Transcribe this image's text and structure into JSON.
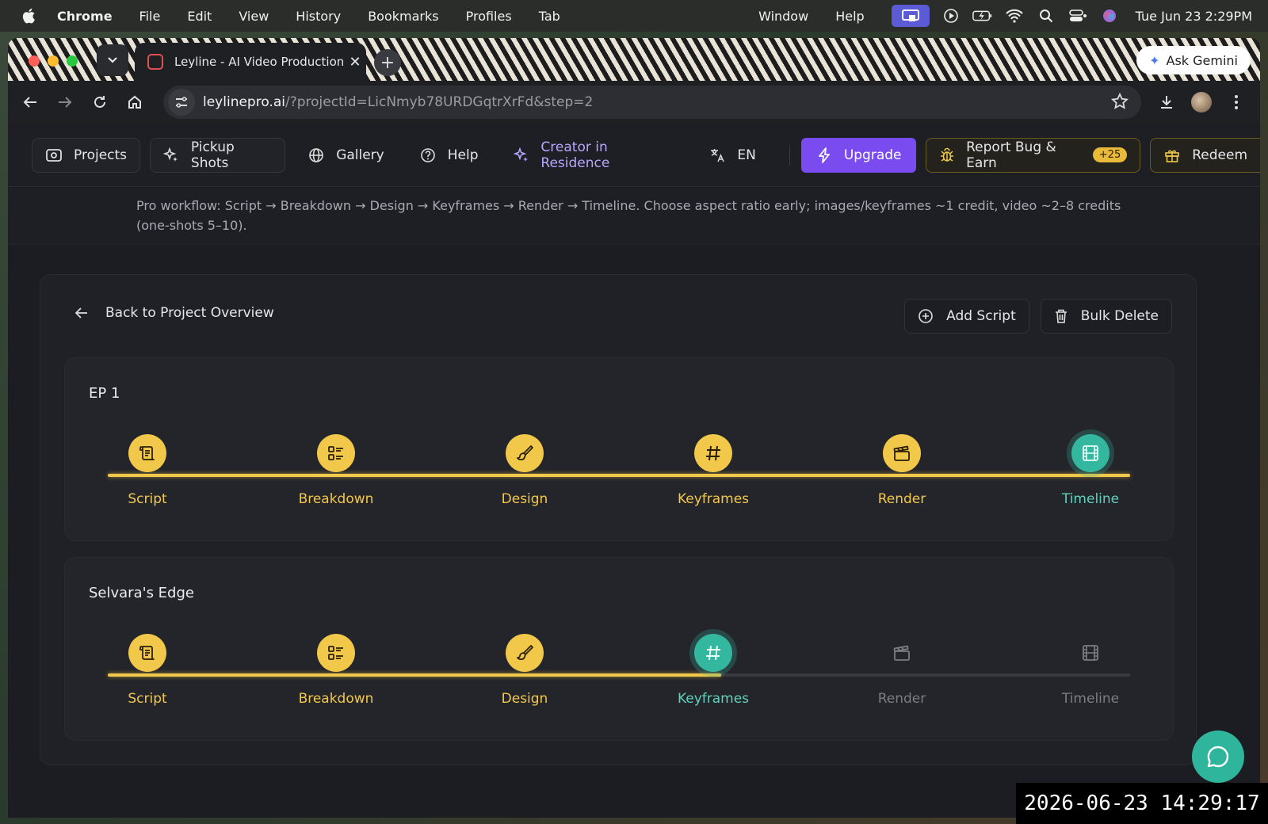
{
  "menubar": {
    "app": "Chrome",
    "items": [
      "File",
      "Edit",
      "View",
      "History",
      "Bookmarks",
      "Profiles",
      "Tab"
    ],
    "right_items": [
      "Window",
      "Help"
    ],
    "clock": "Tue Jun 23  2:29PM"
  },
  "browser": {
    "tab_title": "Leyline - AI Video Production",
    "ask_gemini": "Ask Gemini",
    "url_host": "leylinepro.ai",
    "url_path": "/?projectId=LicNmyb78URDGqtrXrFd&step=2"
  },
  "nav": {
    "projects": "Projects",
    "pickup_shots": "Pickup Shots",
    "gallery": "Gallery",
    "help": "Help",
    "creator": "Creator in Residence",
    "lang": "EN",
    "upgrade": "Upgrade",
    "report": "Report Bug & Earn",
    "report_badge": "+25",
    "redeem": "Redeem"
  },
  "notice": "Pro workflow: Script → Breakdown → Design → Keyframes → Render → Timeline. Choose aspect ratio early; images/keyframes ~1 credit, video ~2–8 credits (one-shots 5–10).",
  "panel": {
    "back": "Back to Project Overview",
    "add_script": "Add Script",
    "bulk_delete": "Bulk Delete"
  },
  "scripts": [
    {
      "title": "EP 1",
      "progress": 1.0,
      "steps": [
        {
          "label": "Script",
          "state": "done",
          "icon": "script-icon"
        },
        {
          "label": "Breakdown",
          "state": "done",
          "icon": "list-icon"
        },
        {
          "label": "Design",
          "state": "done",
          "icon": "brush-icon"
        },
        {
          "label": "Keyframes",
          "state": "done",
          "icon": "hash-icon"
        },
        {
          "label": "Render",
          "state": "done",
          "icon": "clapper-icon"
        },
        {
          "label": "Timeline",
          "state": "current",
          "icon": "film-icon"
        }
      ]
    },
    {
      "title": "Selvara's Edge",
      "progress": 0.6,
      "steps": [
        {
          "label": "Script",
          "state": "done",
          "icon": "script-icon"
        },
        {
          "label": "Breakdown",
          "state": "done",
          "icon": "list-icon"
        },
        {
          "label": "Design",
          "state": "done",
          "icon": "brush-icon"
        },
        {
          "label": "Keyframes",
          "state": "current",
          "icon": "hash-icon"
        },
        {
          "label": "Render",
          "state": "pending",
          "icon": "clapper-icon"
        },
        {
          "label": "Timeline",
          "state": "pending",
          "icon": "film-icon"
        }
      ]
    }
  ],
  "timestamp": "2026-06-23 14:29:17",
  "colors": {
    "done": "#f2c84b",
    "current": "#33b89f",
    "upgrade": "#7a4cf0"
  }
}
